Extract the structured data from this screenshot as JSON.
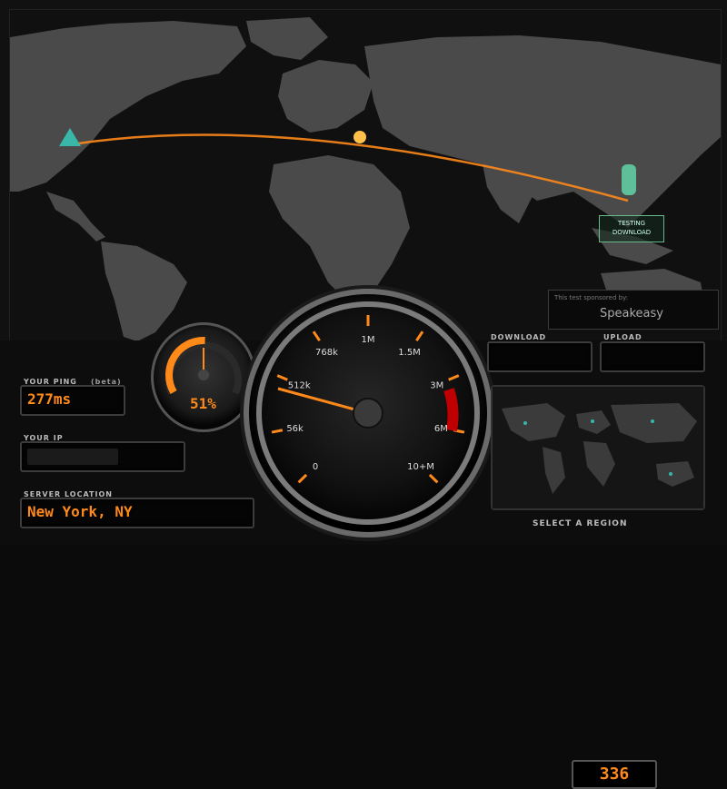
{
  "sponsor": {
    "caption": "This test sponsored by:",
    "name": "Speakeasy"
  },
  "status": {
    "line1": "TESTING",
    "line2": "DOWNLOAD"
  },
  "ping": {
    "label": "YOUR PING",
    "beta": "(beta)",
    "value": "277ms"
  },
  "ip": {
    "label": "YOUR IP",
    "value": ""
  },
  "server": {
    "label": "SERVER LOCATION",
    "value": "New York, NY"
  },
  "progress": {
    "percent_text": "51%",
    "percent": 51
  },
  "speedometer": {
    "readout": "336",
    "ticks": [
      "0",
      "56k",
      "512k",
      "768k",
      "1M",
      "1.5M",
      "3M",
      "6M",
      "10+M"
    ],
    "needle_value": "336"
  },
  "results": {
    "download_label": "DOWNLOAD",
    "upload_label": "UPLOAD",
    "download_value": "",
    "upload_value": ""
  },
  "region": {
    "title": "SELECT A REGION"
  },
  "colors": {
    "accent": "#ff8a1a",
    "panel": "#050505",
    "map_land": "#4a4a4a",
    "redzone": "#c00000"
  }
}
